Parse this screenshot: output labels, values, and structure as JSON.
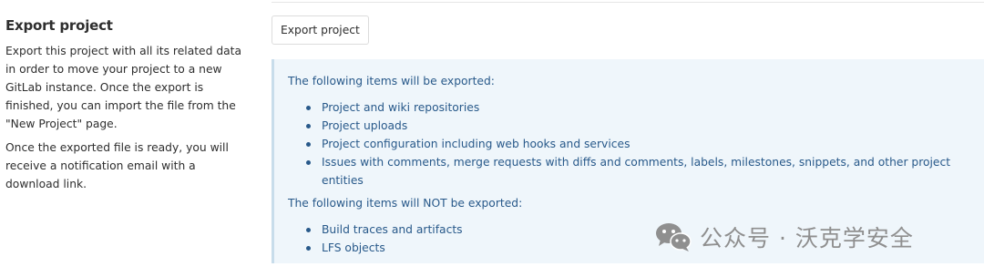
{
  "section": {
    "title": "Export project",
    "description_1": "Export this project with all its related data in order to move your project to a new GitLab instance. Once the export is finished, you can import the file from the \"New Project\" page.",
    "description_2": "Once the exported file is ready, you will receive a notification email with a download link."
  },
  "export_button_label": "Export project",
  "info": {
    "exported_heading": "The following items will be exported:",
    "exported_items": [
      "Project and wiki repositories",
      "Project uploads",
      "Project configuration including web hooks and services",
      "Issues with comments, merge requests with diffs and comments, labels, milestones, snippets, and other project entities"
    ],
    "not_exported_heading": "The following items will NOT be exported:",
    "not_exported_items": [
      "Build traces and artifacts",
      "LFS objects"
    ]
  },
  "watermark": {
    "text": "公众号 · 沃克学安全",
    "icon": "wechat-icon"
  },
  "colors": {
    "panel_background": "#eff6fb",
    "panel_text": "#28598a",
    "panel_border": "#c8ddeb"
  }
}
